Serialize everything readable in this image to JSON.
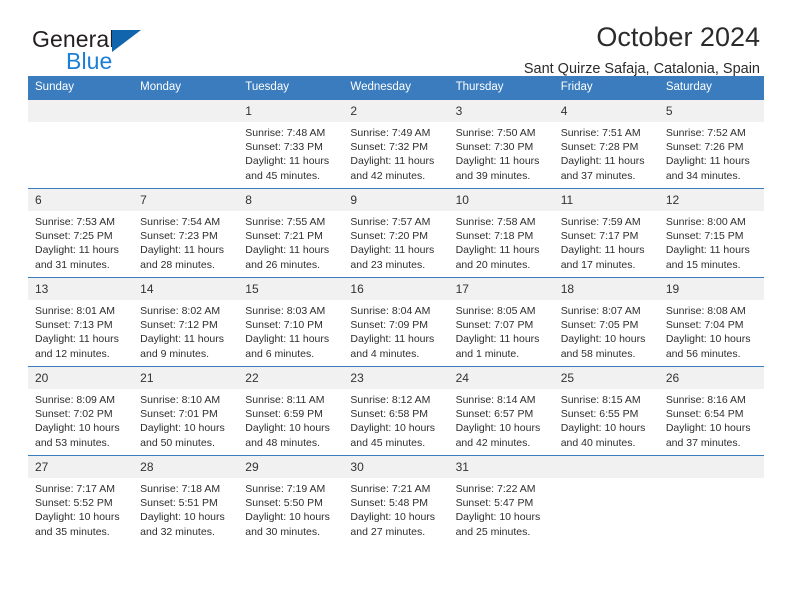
{
  "brand": {
    "name_top": "General",
    "name_bottom": "Blue",
    "accent_color": "#1b7fd4",
    "triangle_color": "#1165ad"
  },
  "header": {
    "title": "October 2024",
    "subtitle": "Sant Quirze Safaja, Catalonia, Spain"
  },
  "calendar": {
    "header_bg": "#3a7cbe",
    "daynum_bg": "#f1f1f1",
    "weekdays": [
      "Sunday",
      "Monday",
      "Tuesday",
      "Wednesday",
      "Thursday",
      "Friday",
      "Saturday"
    ],
    "weeks": [
      [
        {
          "day": "",
          "empty": true
        },
        {
          "day": "",
          "empty": true
        },
        {
          "day": "1",
          "sunrise": "Sunrise: 7:48 AM",
          "sunset": "Sunset: 7:33 PM",
          "daylight": "Daylight: 11 hours and 45 minutes."
        },
        {
          "day": "2",
          "sunrise": "Sunrise: 7:49 AM",
          "sunset": "Sunset: 7:32 PM",
          "daylight": "Daylight: 11 hours and 42 minutes."
        },
        {
          "day": "3",
          "sunrise": "Sunrise: 7:50 AM",
          "sunset": "Sunset: 7:30 PM",
          "daylight": "Daylight: 11 hours and 39 minutes."
        },
        {
          "day": "4",
          "sunrise": "Sunrise: 7:51 AM",
          "sunset": "Sunset: 7:28 PM",
          "daylight": "Daylight: 11 hours and 37 minutes."
        },
        {
          "day": "5",
          "sunrise": "Sunrise: 7:52 AM",
          "sunset": "Sunset: 7:26 PM",
          "daylight": "Daylight: 11 hours and 34 minutes."
        }
      ],
      [
        {
          "day": "6",
          "sunrise": "Sunrise: 7:53 AM",
          "sunset": "Sunset: 7:25 PM",
          "daylight": "Daylight: 11 hours and 31 minutes."
        },
        {
          "day": "7",
          "sunrise": "Sunrise: 7:54 AM",
          "sunset": "Sunset: 7:23 PM",
          "daylight": "Daylight: 11 hours and 28 minutes."
        },
        {
          "day": "8",
          "sunrise": "Sunrise: 7:55 AM",
          "sunset": "Sunset: 7:21 PM",
          "daylight": "Daylight: 11 hours and 26 minutes."
        },
        {
          "day": "9",
          "sunrise": "Sunrise: 7:57 AM",
          "sunset": "Sunset: 7:20 PM",
          "daylight": "Daylight: 11 hours and 23 minutes."
        },
        {
          "day": "10",
          "sunrise": "Sunrise: 7:58 AM",
          "sunset": "Sunset: 7:18 PM",
          "daylight": "Daylight: 11 hours and 20 minutes."
        },
        {
          "day": "11",
          "sunrise": "Sunrise: 7:59 AM",
          "sunset": "Sunset: 7:17 PM",
          "daylight": "Daylight: 11 hours and 17 minutes."
        },
        {
          "day": "12",
          "sunrise": "Sunrise: 8:00 AM",
          "sunset": "Sunset: 7:15 PM",
          "daylight": "Daylight: 11 hours and 15 minutes."
        }
      ],
      [
        {
          "day": "13",
          "sunrise": "Sunrise: 8:01 AM",
          "sunset": "Sunset: 7:13 PM",
          "daylight": "Daylight: 11 hours and 12 minutes."
        },
        {
          "day": "14",
          "sunrise": "Sunrise: 8:02 AM",
          "sunset": "Sunset: 7:12 PM",
          "daylight": "Daylight: 11 hours and 9 minutes."
        },
        {
          "day": "15",
          "sunrise": "Sunrise: 8:03 AM",
          "sunset": "Sunset: 7:10 PM",
          "daylight": "Daylight: 11 hours and 6 minutes."
        },
        {
          "day": "16",
          "sunrise": "Sunrise: 8:04 AM",
          "sunset": "Sunset: 7:09 PM",
          "daylight": "Daylight: 11 hours and 4 minutes."
        },
        {
          "day": "17",
          "sunrise": "Sunrise: 8:05 AM",
          "sunset": "Sunset: 7:07 PM",
          "daylight": "Daylight: 11 hours and 1 minute."
        },
        {
          "day": "18",
          "sunrise": "Sunrise: 8:07 AM",
          "sunset": "Sunset: 7:05 PM",
          "daylight": "Daylight: 10 hours and 58 minutes."
        },
        {
          "day": "19",
          "sunrise": "Sunrise: 8:08 AM",
          "sunset": "Sunset: 7:04 PM",
          "daylight": "Daylight: 10 hours and 56 minutes."
        }
      ],
      [
        {
          "day": "20",
          "sunrise": "Sunrise: 8:09 AM",
          "sunset": "Sunset: 7:02 PM",
          "daylight": "Daylight: 10 hours and 53 minutes."
        },
        {
          "day": "21",
          "sunrise": "Sunrise: 8:10 AM",
          "sunset": "Sunset: 7:01 PM",
          "daylight": "Daylight: 10 hours and 50 minutes."
        },
        {
          "day": "22",
          "sunrise": "Sunrise: 8:11 AM",
          "sunset": "Sunset: 6:59 PM",
          "daylight": "Daylight: 10 hours and 48 minutes."
        },
        {
          "day": "23",
          "sunrise": "Sunrise: 8:12 AM",
          "sunset": "Sunset: 6:58 PM",
          "daylight": "Daylight: 10 hours and 45 minutes."
        },
        {
          "day": "24",
          "sunrise": "Sunrise: 8:14 AM",
          "sunset": "Sunset: 6:57 PM",
          "daylight": "Daylight: 10 hours and 42 minutes."
        },
        {
          "day": "25",
          "sunrise": "Sunrise: 8:15 AM",
          "sunset": "Sunset: 6:55 PM",
          "daylight": "Daylight: 10 hours and 40 minutes."
        },
        {
          "day": "26",
          "sunrise": "Sunrise: 8:16 AM",
          "sunset": "Sunset: 6:54 PM",
          "daylight": "Daylight: 10 hours and 37 minutes."
        }
      ],
      [
        {
          "day": "27",
          "sunrise": "Sunrise: 7:17 AM",
          "sunset": "Sunset: 5:52 PM",
          "daylight": "Daylight: 10 hours and 35 minutes."
        },
        {
          "day": "28",
          "sunrise": "Sunrise: 7:18 AM",
          "sunset": "Sunset: 5:51 PM",
          "daylight": "Daylight: 10 hours and 32 minutes."
        },
        {
          "day": "29",
          "sunrise": "Sunrise: 7:19 AM",
          "sunset": "Sunset: 5:50 PM",
          "daylight": "Daylight: 10 hours and 30 minutes."
        },
        {
          "day": "30",
          "sunrise": "Sunrise: 7:21 AM",
          "sunset": "Sunset: 5:48 PM",
          "daylight": "Daylight: 10 hours and 27 minutes."
        },
        {
          "day": "31",
          "sunrise": "Sunrise: 7:22 AM",
          "sunset": "Sunset: 5:47 PM",
          "daylight": "Daylight: 10 hours and 25 minutes."
        },
        {
          "day": "",
          "empty": true
        },
        {
          "day": "",
          "empty": true
        }
      ]
    ]
  }
}
